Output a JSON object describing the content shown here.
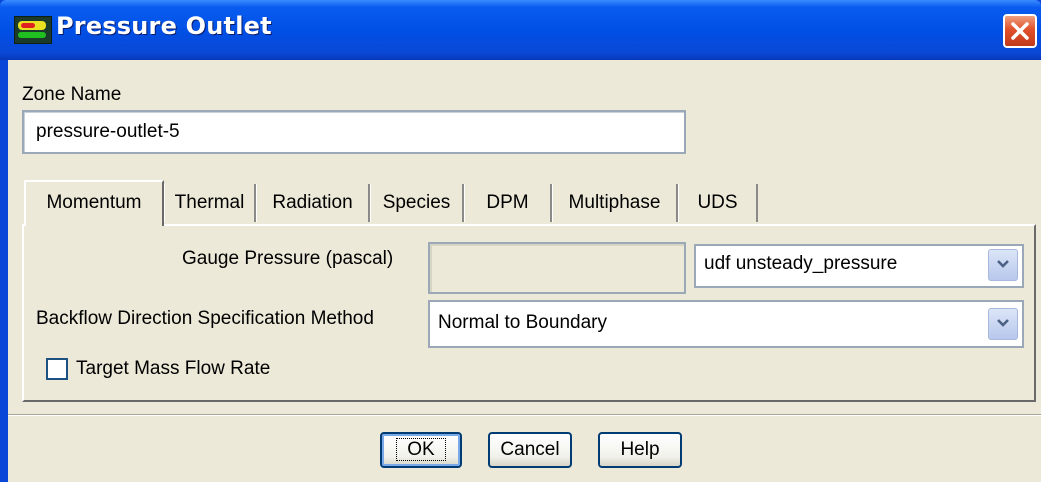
{
  "window": {
    "title": "Pressure Outlet",
    "title_icon": "fluent-app-icon",
    "close_icon": "close-icon",
    "colors": {
      "titlebar": "#0050e6",
      "client": "#ece9d8",
      "close": "#e0502a"
    }
  },
  "zone": {
    "label": "Zone Name",
    "value": "pressure-outlet-5"
  },
  "tabs": [
    {
      "label": "Momentum",
      "active": true
    },
    {
      "label": "Thermal"
    },
    {
      "label": "Radiation"
    },
    {
      "label": "Species"
    },
    {
      "label": "DPM"
    },
    {
      "label": "Multiphase"
    },
    {
      "label": "UDS"
    }
  ],
  "momentum": {
    "gauge_pressure_label": "Gauge Pressure (pascal)",
    "gauge_pressure_value": "",
    "gauge_pressure_profile": "udf unsteady_pressure",
    "backflow_label": "Backflow Direction Specification Method",
    "backflow_value": "Normal to Boundary",
    "target_mass_flow_label": "Target Mass Flow Rate",
    "target_mass_flow_checked": false
  },
  "buttons": {
    "ok": "OK",
    "cancel": "Cancel",
    "help": "Help"
  }
}
